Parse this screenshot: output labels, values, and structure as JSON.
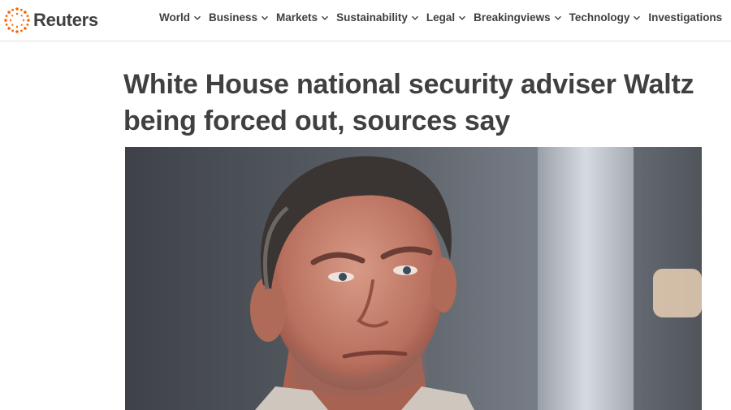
{
  "brand": {
    "name": "Reuters",
    "accent": "#fa6400"
  },
  "nav": [
    {
      "label": "World",
      "icon": "chevron-down-icon"
    },
    {
      "label": "Business",
      "icon": "chevron-down-icon"
    },
    {
      "label": "Markets",
      "icon": "chevron-down-icon"
    },
    {
      "label": "Sustainability",
      "icon": "chevron-down-icon"
    },
    {
      "label": "Legal",
      "icon": "chevron-down-icon"
    },
    {
      "label": "Breakingviews",
      "icon": "chevron-down-icon"
    },
    {
      "label": "Technology",
      "icon": "chevron-down-icon"
    },
    {
      "label": "Investigations"
    }
  ],
  "article": {
    "headline": "White House national security adviser Waltz being forced out, sources say"
  },
  "colors": {
    "text": "#404040",
    "divider": "#e2e2e2"
  }
}
